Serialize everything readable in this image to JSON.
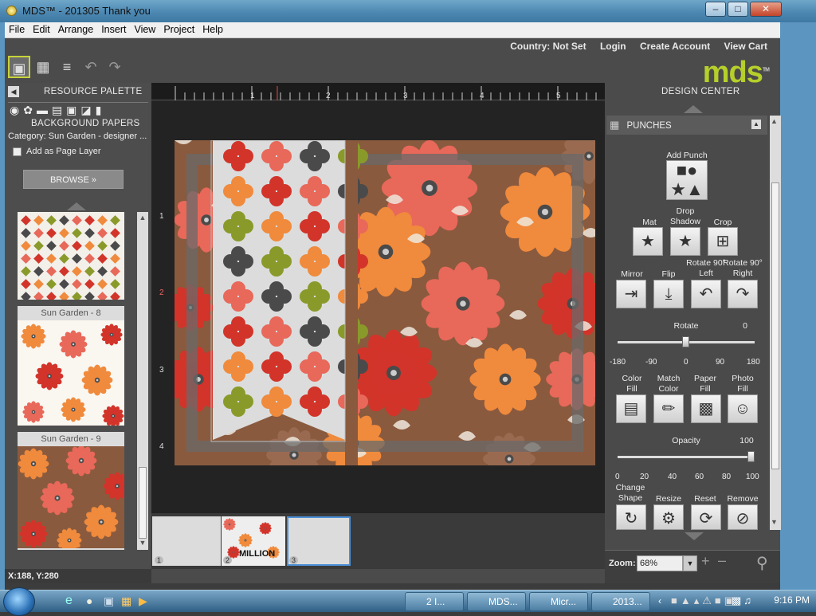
{
  "window": {
    "title": "MDS™ - 201305 Thank you",
    "min": "–",
    "max": "□",
    "close": "✕"
  },
  "menu": [
    "File",
    "Edit",
    "Arrange",
    "Insert",
    "View",
    "Project",
    "Help"
  ],
  "toplinks": {
    "country": "Country: Not Set",
    "login": "Login",
    "create": "Create Account",
    "cart": "View Cart"
  },
  "logo": "mds",
  "logo_tm": "TM",
  "resource": {
    "title": "RESOURCE PALETTE",
    "section": "BACKGROUND PAPERS",
    "category": "Category: Sun Garden - designer ...",
    "add_layer": "Add as Page Layer",
    "browse": "BROWSE  »",
    "thumbs": [
      {
        "caption": "Sun Garden - 8"
      },
      {
        "caption": "Sun Garden - 9"
      }
    ]
  },
  "ruler": {
    "marks": [
      "1",
      "2",
      "3",
      "4",
      "5"
    ],
    "vmarks": [
      "1",
      "2",
      "3",
      "4"
    ]
  },
  "filmstrip": {
    "pages": [
      "1",
      "2",
      "3"
    ],
    "thumb_text": "MILLION"
  },
  "status": "X:188, Y:280",
  "design": {
    "title": "DESIGN CENTER",
    "section": "PUNCHES",
    "add_punch": "Add Punch",
    "mat": "Mat",
    "drop_shadow": "Drop Shadow",
    "crop": "Crop",
    "mirror": "Mirror",
    "flip": "Flip",
    "rot_left": "Rotate 90° Left",
    "rot_right": "Rotate 90° Right",
    "rotate_label": "Rotate",
    "rotate_value": "0",
    "rotate_ticks": [
      "-180",
      "-90",
      "0",
      "90",
      "180"
    ],
    "rotate_fraction": 0.5,
    "color_fill": "Color Fill",
    "match_color": "Match Color",
    "paper_fill": "Paper Fill",
    "photo_fill": "Photo Fill",
    "opacity_label": "Opacity",
    "opacity_value": "100",
    "opacity_ticks": [
      "0",
      "20",
      "40",
      "60",
      "80",
      "100"
    ],
    "opacity_fraction": 1.0,
    "change_shape": "Change Shape",
    "resize": "Resize",
    "reset": "Reset",
    "remove": "Remove"
  },
  "zoom": {
    "label": "Zoom:",
    "value": "68%"
  },
  "taskbar": {
    "items": [
      "2 I...",
      "MDS...",
      "Micr...",
      "2013..."
    ],
    "time": "9:16 PM"
  }
}
